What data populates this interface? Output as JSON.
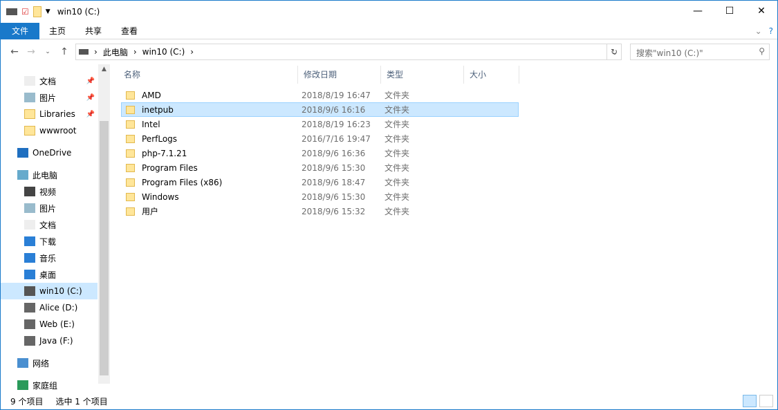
{
  "window": {
    "title": "win10 (C:)",
    "minimize": "—",
    "maximize": "☐",
    "close": "✕"
  },
  "ribbon": {
    "tabs": [
      "文件",
      "主页",
      "共享",
      "查看"
    ]
  },
  "address": {
    "crumbs": [
      "此电脑",
      "win10 (C:)"
    ],
    "search_placeholder": "搜索\"win10 (C:)\""
  },
  "sidebar": {
    "items": [
      {
        "label": "文档",
        "pinned": true
      },
      {
        "label": "图片",
        "pinned": true
      },
      {
        "label": "Libraries",
        "pinned": true
      },
      {
        "label": "wwwroot"
      },
      {
        "label": "OneDrive"
      },
      {
        "label": "此电脑"
      },
      {
        "label": "视频"
      },
      {
        "label": "图片"
      },
      {
        "label": "文档"
      },
      {
        "label": "下载"
      },
      {
        "label": "音乐"
      },
      {
        "label": "桌面"
      },
      {
        "label": "win10 (C:)",
        "selected": true
      },
      {
        "label": "Alice (D:)"
      },
      {
        "label": "Web (E:)"
      },
      {
        "label": "Java (F:)"
      },
      {
        "label": "网络"
      },
      {
        "label": "家庭组"
      }
    ]
  },
  "columns": [
    "名称",
    "修改日期",
    "类型",
    "大小"
  ],
  "files": [
    {
      "name": "AMD",
      "date": "2018/8/19 16:47",
      "type": "文件夹"
    },
    {
      "name": "inetpub",
      "date": "2018/9/6 16:16",
      "type": "文件夹",
      "selected": true
    },
    {
      "name": "Intel",
      "date": "2018/8/19 16:23",
      "type": "文件夹"
    },
    {
      "name": "PerfLogs",
      "date": "2016/7/16 19:47",
      "type": "文件夹"
    },
    {
      "name": "php-7.1.21",
      "date": "2018/9/6 16:36",
      "type": "文件夹"
    },
    {
      "name": "Program Files",
      "date": "2018/9/6 15:30",
      "type": "文件夹"
    },
    {
      "name": "Program Files (x86)",
      "date": "2018/9/6 18:47",
      "type": "文件夹"
    },
    {
      "name": "Windows",
      "date": "2018/9/6 15:30",
      "type": "文件夹"
    },
    {
      "name": "用户",
      "date": "2018/9/6 15:32",
      "type": "文件夹"
    }
  ],
  "status": {
    "count": "9 个项目",
    "selected": "选中 1 个项目"
  }
}
